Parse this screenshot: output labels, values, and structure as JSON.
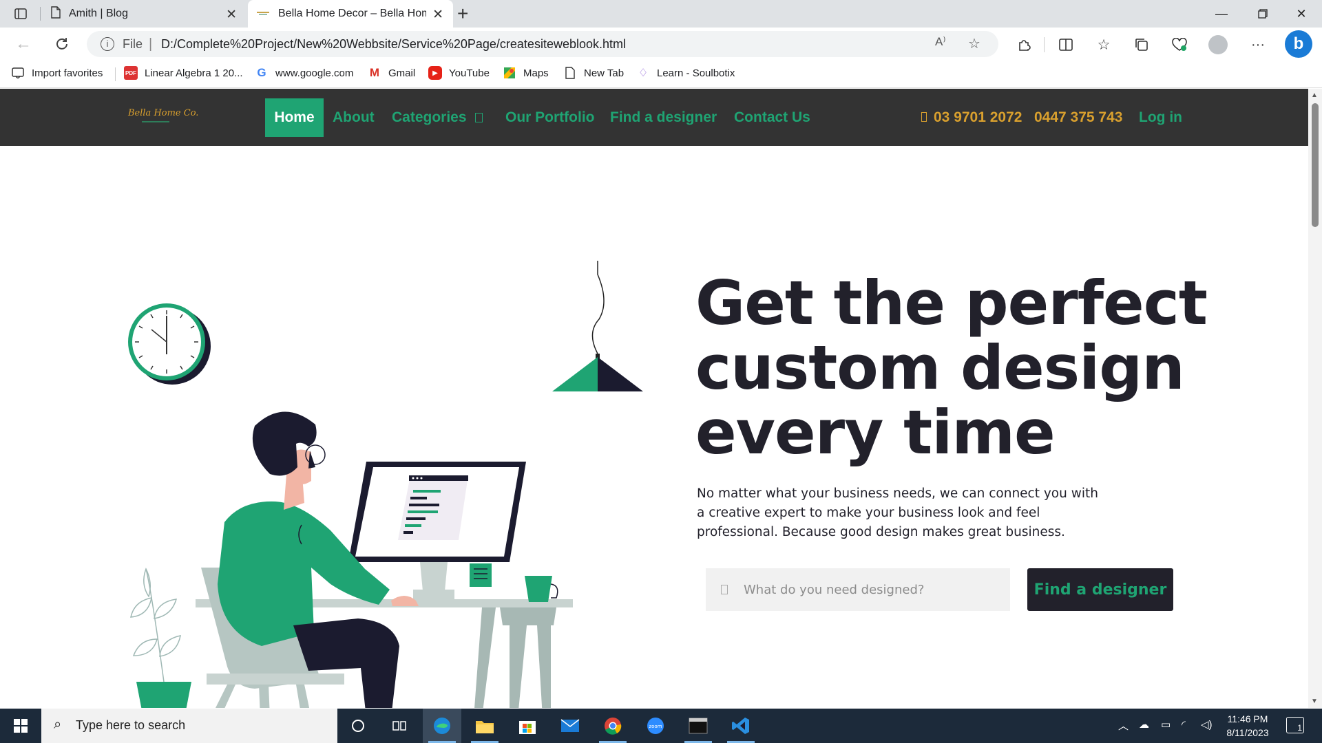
{
  "browser": {
    "tabs": [
      {
        "title": "Amith | Blog",
        "icon": "page-icon"
      },
      {
        "title": "Bella Home Decor – Bella Home D",
        "icon": "bella-favicon",
        "active": true
      }
    ],
    "address": {
      "scheme": "File",
      "url": "D:/Complete%20Project/New%20Webbsite/Service%20Page/createsiteweblook.html"
    },
    "favorites": [
      {
        "label": "Import favorites",
        "icon": "import-icon"
      },
      {
        "label": "Linear Algebra 1 20...",
        "icon": "pdf-icon"
      },
      {
        "label": "www.google.com",
        "icon": "google-icon"
      },
      {
        "label": "Gmail",
        "icon": "gmail-icon"
      },
      {
        "label": "YouTube",
        "icon": "youtube-icon"
      },
      {
        "label": "Maps",
        "icon": "maps-icon"
      },
      {
        "label": "New Tab",
        "icon": "page-icon"
      },
      {
        "label": "Learn - Soulbotix",
        "icon": "soulbotix-icon"
      }
    ]
  },
  "site": {
    "logo": "Bella Home Co.",
    "nav": {
      "home": "Home",
      "about": "About",
      "categories": "Categories",
      "portfolio": "Our Portfolio",
      "find_designer": "Find a designer",
      "contact": "Contact Us",
      "phone1": "03 9701 2072",
      "phone2": "0447 375 743",
      "login": "Log in"
    },
    "hero": {
      "title": "Get the perfect custom design every time",
      "text": "No matter what your business needs, we can connect you with a creative expert to make your business look and feel professional. Because good design makes great business.",
      "search_placeholder": "What do you need designed?",
      "button": "Find a designer"
    },
    "colors": {
      "accent": "#1fa473",
      "dark": "#22212b",
      "nav_bg": "#333333",
      "gold": "#d9a02e"
    }
  },
  "taskbar": {
    "search_placeholder": "Type here to search",
    "time": "11:46 PM",
    "date": "8/11/2023",
    "notifications": "1"
  }
}
